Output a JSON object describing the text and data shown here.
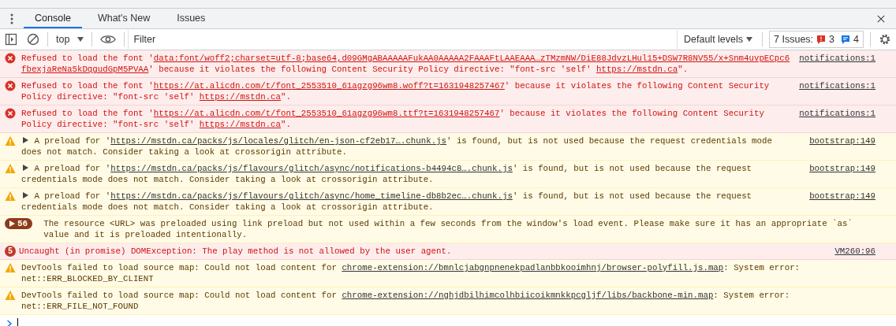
{
  "tabs": [
    {
      "label": "Console",
      "selected": true
    },
    {
      "label": "What's New",
      "selected": false
    },
    {
      "label": "Issues",
      "selected": false
    }
  ],
  "toolbar": {
    "context": "top",
    "filter": {
      "placeholder": "Filter"
    },
    "levels": "Default levels",
    "issues": {
      "label": "7 Issues:",
      "errors": "3",
      "infos": "4"
    }
  },
  "messages": [
    {
      "kind": "error",
      "expandable": false,
      "parts": [
        {
          "text": "Refused to load the font '",
          "link": false
        },
        {
          "text": "data:font/woff2;charset=utf-8;base64,d09GMgABAAAAAFukAA0AAAAA2FAAAFtLAAEAAA…zTMzmNW/DiE88JdvzLHul15+DSW7R8NV55/x+Snm4uvpECpc6fbexjaReNa5kDqgudGpM5PVAA",
          "link": true
        },
        {
          "text": "' because it violates the following Content Security Policy directive: \"font-src 'self' ",
          "link": false
        },
        {
          "text": "https://mstdn.ca",
          "link": true
        },
        {
          "text": "\".",
          "link": false
        }
      ],
      "source": "notifications:1"
    },
    {
      "kind": "error",
      "expandable": false,
      "parts": [
        {
          "text": "Refused to load the font '",
          "link": false
        },
        {
          "text": "https://at.alicdn.com/t/font_2553510_61agzg96wm8.woff?t=1631948257467",
          "link": true
        },
        {
          "text": "' because it violates the following Content Security Policy directive: \"font-src 'self' ",
          "link": false
        },
        {
          "text": "https://mstdn.ca",
          "link": true
        },
        {
          "text": "\".",
          "link": false
        }
      ],
      "source": "notifications:1"
    },
    {
      "kind": "error",
      "expandable": false,
      "parts": [
        {
          "text": "Refused to load the font '",
          "link": false
        },
        {
          "text": "https://at.alicdn.com/t/font_2553510_61agzg96wm8.ttf?t=1631948257467",
          "link": true
        },
        {
          "text": "' because it violates the following Content Security Policy directive: \"font-src 'self' ",
          "link": false
        },
        {
          "text": "https://mstdn.ca",
          "link": true
        },
        {
          "text": "\".",
          "link": false
        }
      ],
      "source": "notifications:1"
    },
    {
      "kind": "warning",
      "expandable": true,
      "parts": [
        {
          "text": "A preload for '",
          "link": false
        },
        {
          "text": "https://mstdn.ca/packs/js/locales/glitch/en-json-cf2eb17….chunk.js",
          "link": true
        },
        {
          "text": "' is found, but is not used because the request credentials mode does not match. Consider taking a look at crossorigin attribute.",
          "link": false
        }
      ],
      "source": "bootstrap:149"
    },
    {
      "kind": "warning",
      "expandable": true,
      "parts": [
        {
          "text": "A preload for '",
          "link": false
        },
        {
          "text": "https://mstdn.ca/packs/js/flavours/glitch/async/notifications-b4494c8….chunk.js",
          "link": true
        },
        {
          "text": "' is found, but is not used because the request credentials mode does not match. Consider taking a look at crossorigin attribute.",
          "link": false
        }
      ],
      "source": "bootstrap:149"
    },
    {
      "kind": "warning",
      "expandable": true,
      "parts": [
        {
          "text": "A preload for '",
          "link": false
        },
        {
          "text": "https://mstdn.ca/packs/js/flavours/glitch/async/home_timeline-db8b2ec….chunk.js",
          "link": true
        },
        {
          "text": "' is found, but is not used because the request credentials mode does not match. Consider taking a look at crossorigin attribute.",
          "link": false
        }
      ],
      "source": "bootstrap:149"
    },
    {
      "kind": "violation",
      "expandable": false,
      "count": "56",
      "parts": [
        {
          "text": "The resource <URL> was preloaded using link preload but not used within a few seconds from the window's load event. Please make sure it has an appropriate `as` value and it is preloaded intentionally.",
          "link": false
        }
      ]
    },
    {
      "kind": "error",
      "expandable": false,
      "count": "5",
      "parts": [
        {
          "text": "Uncaught (in promise) DOMException: The play method is not allowed by the user agent.",
          "link": false
        }
      ],
      "source": "VM260:96"
    },
    {
      "kind": "warning",
      "expandable": false,
      "parts": [
        {
          "text": "DevTools failed to load source map: Could not load content for ",
          "link": false
        },
        {
          "text": "chrome-extension://bmnlcjabgnpnenekpadlanbbkooimhnj/browser-polyfill.js.map",
          "link": true
        },
        {
          "text": ": System error: net::ERR_BLOCKED_BY_CLIENT",
          "link": false
        }
      ]
    },
    {
      "kind": "warning",
      "expandable": false,
      "parts": [
        {
          "text": "DevTools failed to load source map: Could not load content for ",
          "link": false
        },
        {
          "text": "chrome-extension://nghjdbilhimcolhbiicoikmnkkpcgljf/libs/backbone-min.map",
          "link": true
        },
        {
          "text": ": System error: net::ERR_FILE_NOT_FOUND",
          "link": false
        }
      ]
    }
  ]
}
